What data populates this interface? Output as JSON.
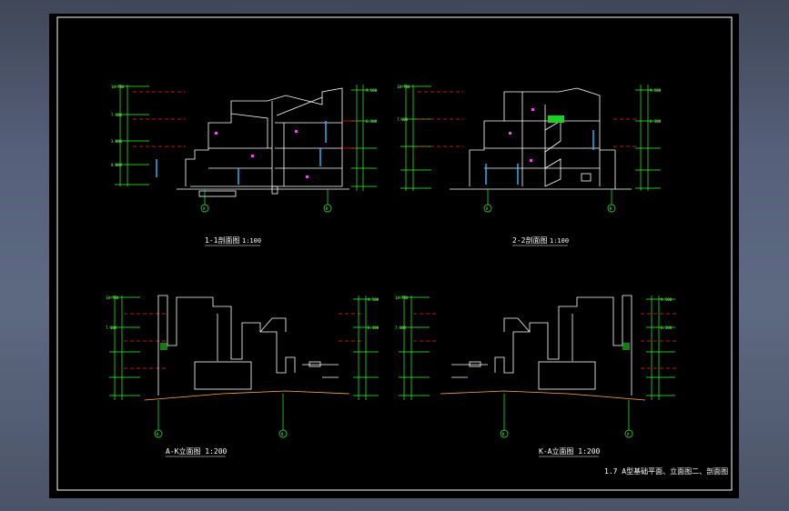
{
  "sheet": {
    "title": "1.7  A型基础平面、立面图二、剖面图",
    "colors": {
      "background": "#000000",
      "frame": "#ffffff",
      "dimension": "#2cff2c",
      "wall": "#ffffff",
      "level_mark": "#ff2020",
      "accent_magenta": "#ff40ff",
      "accent_cyan": "#30c0ff",
      "ground": "#ffb040",
      "fill_green": "#20d020"
    }
  },
  "drawings": [
    {
      "id": "section-1-1",
      "title": "1-1剖面图",
      "scale": "1:100",
      "axis_left": "A",
      "axis_right": "K"
    },
    {
      "id": "section-2-2",
      "title": "2-2剖面图",
      "scale": "1:100",
      "axis_left": "A",
      "axis_right": "K"
    },
    {
      "id": "elevation-a-k",
      "title": "A-K立面图 1:200",
      "axis_left": "A",
      "axis_right": "K"
    },
    {
      "id": "elevation-k-a",
      "title": "K-A立面图 1:200",
      "axis_left": "K",
      "axis_right": "A"
    }
  ]
}
